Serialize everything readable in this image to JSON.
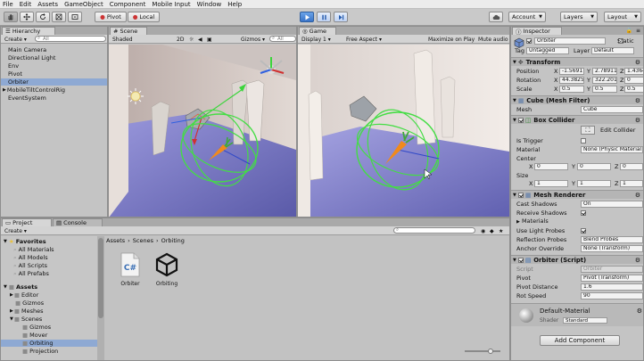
{
  "menu": [
    "File",
    "Edit",
    "Assets",
    "GameObject",
    "Component",
    "Mobile Input",
    "Window",
    "Help"
  ],
  "toolbar": {
    "pivot": "Pivot",
    "local": "Local",
    "account": "Account",
    "layers": "Layers",
    "layout": "Layout"
  },
  "hierarchy": {
    "tab": "Hierarchy",
    "create": "Create",
    "search": "All",
    "items": [
      "Main Camera",
      "Directional Light",
      "Env",
      "Pivot",
      "Orbiter",
      "MobileTiltControlRig",
      "EventSystem"
    ]
  },
  "scene": {
    "tab": "Scene",
    "shading": "Shaded",
    "mode_2d": "2D",
    "gizmos": "Gizmos",
    "search": "All"
  },
  "game": {
    "tab": "Game",
    "display": "Display 1",
    "aspect": "Free Aspect",
    "maximize": "Maximize on Play",
    "mute": "Mute audio"
  },
  "project": {
    "tab": "Project",
    "console_tab": "Console",
    "create": "Create",
    "breadcrumb": [
      "Assets",
      "Scenes",
      "Orbiting"
    ],
    "favorites_label": "Favorites",
    "favorites": [
      "All Materials",
      "All Models",
      "All Scripts",
      "All Prefabs"
    ],
    "assets_label": "Assets",
    "tree": [
      "Editor",
      "Gizmos",
      "Meshes",
      "Scenes",
      "Gizmos",
      "Mover",
      "Orbiting",
      "Projection"
    ],
    "files": [
      {
        "name": "Orbiter",
        "icon": "csharp-script-icon"
      },
      {
        "name": "Orbiting",
        "icon": "unity-scene-icon"
      }
    ]
  },
  "inspector": {
    "tab": "Inspector",
    "object_name": "Orbiter",
    "static": "Static",
    "tag_label": "Tag",
    "tag": "Untagged",
    "layer_label": "Layer",
    "layer": "Default",
    "transform": {
      "title": "Transform",
      "position_label": "Position",
      "position": [
        "-1.5691",
        "2.78911",
        "1.43645"
      ],
      "rotation_label": "Rotation",
      "rotation": [
        "44.3825",
        "322.201",
        "0"
      ],
      "scale_label": "Scale",
      "scale": [
        "0.5",
        "0.5",
        "0.5"
      ]
    },
    "mesh_filter": {
      "title": "Cube (Mesh Filter)",
      "mesh_label": "Mesh",
      "mesh": "Cube"
    },
    "box_collider": {
      "title": "Box Collider",
      "edit_button": "Edit Collider",
      "is_trigger_label": "Is Trigger",
      "material_label": "Material",
      "material": "None (Physic Material)",
      "center_label": "Center",
      "center": [
        "0",
        "0",
        "0"
      ],
      "size_label": "Size",
      "size": [
        "1",
        "1",
        "1"
      ]
    },
    "mesh_renderer": {
      "title": "Mesh Renderer",
      "cast_shadows_label": "Cast Shadows",
      "cast_shadows": "On",
      "receive_shadows_label": "Receive Shadows",
      "materials_label": "Materials",
      "light_probes_label": "Use Light Probes",
      "reflection_probes_label": "Reflection Probes",
      "reflection_probes": "Blend Probes",
      "anchor_label": "Anchor Override",
      "anchor": "None (Transform)"
    },
    "orbiter_script": {
      "title": "Orbiter (Script)",
      "script_label": "Script",
      "script": "Orbiter",
      "pivot_label": "Pivot",
      "pivot": "Pivot (Transform)",
      "distance_label": "Pivot Distance",
      "distance": "1.6",
      "speed_label": "Rot Speed",
      "speed": "90"
    },
    "material": {
      "name": "Default-Material",
      "shader_label": "Shader",
      "shader": "Standard"
    },
    "add_component": "Add Component"
  },
  "colors": {
    "accent_blue": "#3a74c8",
    "selection": "#8ea9d3",
    "floor": "#8c8cd8",
    "carrot": "#f08a1c",
    "gizmo_green": "#44dd44"
  }
}
